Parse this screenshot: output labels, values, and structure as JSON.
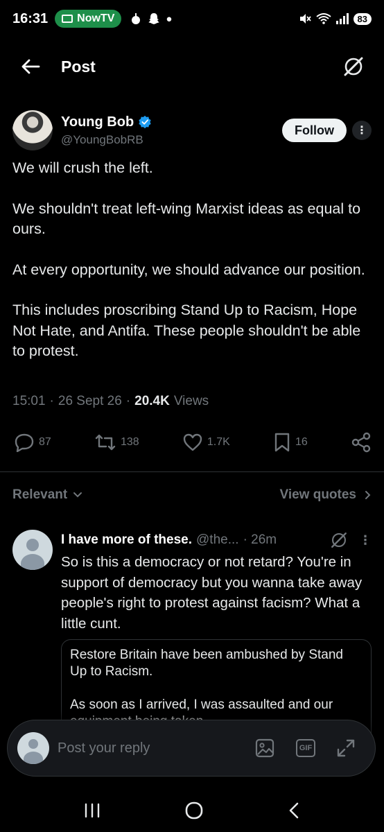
{
  "status_bar": {
    "time": "16:31",
    "app_pill": "NowTV",
    "battery": "83"
  },
  "header": {
    "title": "Post"
  },
  "post": {
    "author_name": "Young Bob",
    "author_handle": "@YoungBobRB",
    "follow_label": "Follow",
    "paragraphs": [
      "We will crush the left.",
      "We shouldn't treat left-wing Marxist ideas as equal to ours.",
      "At every opportunity, we should advance our position.",
      "This includes proscribing Stand Up to Racism, Hope Not Hate, and Antifa. These people shouldn't be able to protest."
    ],
    "time": "15:01",
    "date": "26 Sept 26",
    "views_count": "20.4K",
    "views_label": "Views",
    "sep": "·"
  },
  "actions": {
    "replies": "87",
    "reposts": "138",
    "likes": "1.7K",
    "bookmarks": "16"
  },
  "sort": {
    "relevant_label": "Relevant",
    "view_quotes_label": "View quotes"
  },
  "reply": {
    "name": "I have more of these.",
    "handle": "@the...",
    "time": "· 26m",
    "text": "So is this a democracy or not retard? You're in support of democracy but you wanna take away people's right to protest against facism? What a little cunt.",
    "quote_paragraphs": [
      "Restore Britain have been ambushed by Stand Up to Racism.",
      "As soon as I arrived, I was assaulted and our equipment being taken."
    ]
  },
  "composer": {
    "placeholder": "Post your reply",
    "gif_label": "GIF"
  },
  "colors": {
    "background": "#000000",
    "text": "#e7e9ea",
    "muted": "#71767b",
    "verified": "#1d9bf0",
    "follow_bg": "#eff3f4"
  }
}
